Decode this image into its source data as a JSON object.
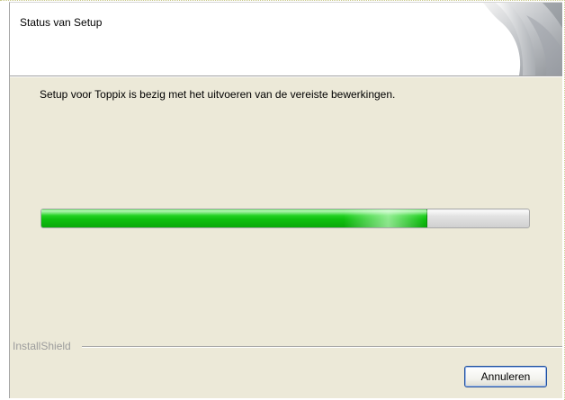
{
  "header": {
    "title": "Status van Setup"
  },
  "message": "Setup voor Toppix is bezig met het uitvoeren van de vereiste bewerkingen.",
  "progress": {
    "fraction": 0.79,
    "fill_color": "#1ccc1c",
    "track_color": "#dcdcdc"
  },
  "brand": {
    "label": "InstallShield"
  },
  "buttons": {
    "cancel_label": "Annuleren"
  },
  "icons": {
    "header_art": "installshield-swoosh-graphic"
  },
  "colors": {
    "dialog_background": "#ece9d8",
    "header_background": "#ffffff",
    "button_border": "#1f4f9e"
  }
}
